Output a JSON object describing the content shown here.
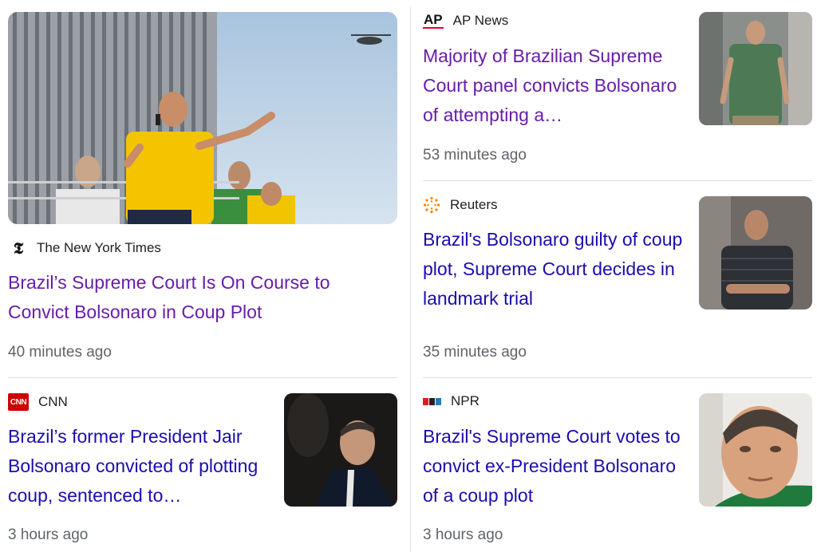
{
  "cards": [
    {
      "source": "The New York Times",
      "logo": "nyt-logo-icon",
      "headline": "Brazil’s Supreme Court Is On Course to Convict Bolsonaro in Coup Plot",
      "time": "40 minutes ago",
      "image": "bolsonaro-rally-yellow-shirt-photo"
    },
    {
      "source": "AP News",
      "logo_text": "AP",
      "headline": "Majority of Brazilian Supreme Court panel convicts Bolsonaro of attempting a…",
      "time": "53 minutes ago",
      "image": "bolsonaro-green-shirt-photo"
    },
    {
      "source": "Reuters",
      "logo": "reuters-logo-icon",
      "headline": "Brazil's Bolsonaro guilty of coup plot, Supreme Court decides in landmark trial",
      "time": "35 minutes ago",
      "image": "bolsonaro-arms-crossed-photo"
    },
    {
      "source": "CNN",
      "logo_text": "CNN",
      "headline": "Brazil’s former President Jair Bolsonaro convicted of plotting coup, sentenced to…",
      "time": "3 hours ago",
      "image": "bolsonaro-suit-profile-photo"
    },
    {
      "source": "NPR",
      "logo": "npr-logo-icon",
      "headline": "Brazil's Supreme Court votes to convict ex-President Bolsonaro of a coup plot",
      "time": "3 hours ago",
      "image": "bolsonaro-closeup-photo"
    }
  ],
  "colors": {
    "link": "#1a0dab",
    "visited": "#681da8",
    "meta": "#5f6368",
    "divider": "#dadce0"
  }
}
